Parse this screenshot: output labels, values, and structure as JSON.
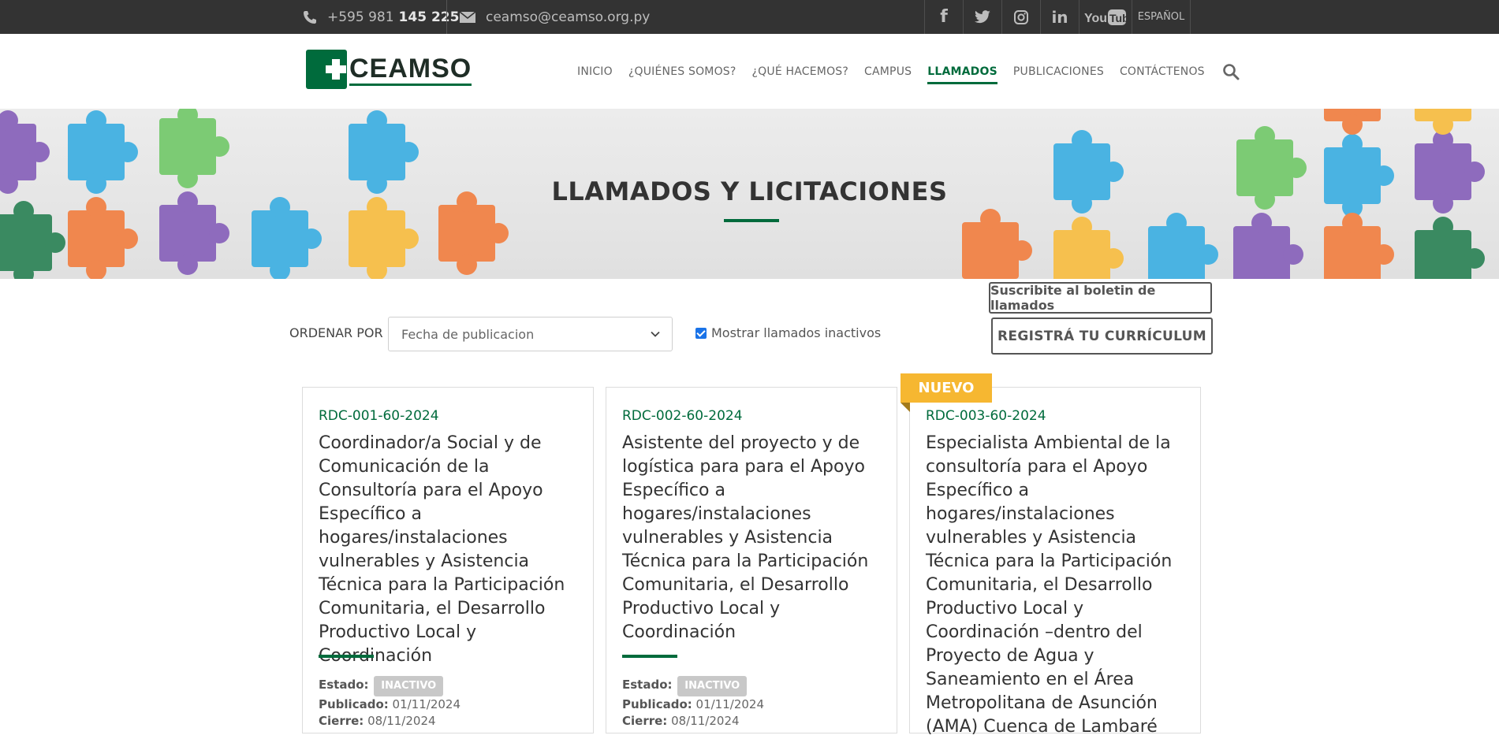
{
  "topbar": {
    "phone_prefix": "+595 981",
    "phone_number": "145 225",
    "email": "ceamso@ceamso.org.py",
    "socials": [
      "facebook-icon",
      "twitter-icon",
      "instagram-icon",
      "linkedin-icon",
      "youtube-icon"
    ],
    "language": "ESPAÑOL"
  },
  "header": {
    "logo_text": "CEAMSO",
    "nav": [
      {
        "label": "INICIO",
        "active": false
      },
      {
        "label": "¿QUIÉNES SOMOS?",
        "active": false
      },
      {
        "label": "¿QUÉ HACEMOS?",
        "active": false
      },
      {
        "label": "CAMPUS",
        "active": false
      },
      {
        "label": "LLAMADOS",
        "active": true
      },
      {
        "label": "PUBLICACIONES",
        "active": false
      },
      {
        "label": "CONTÁCTENOS",
        "active": false
      }
    ]
  },
  "banner": {
    "title": "LLAMADOS Y LICITACIONES"
  },
  "filters": {
    "sort_label": "ORDENAR POR",
    "sort_value": "Fecha de publicacion",
    "inactive_label": "Mostrar llamados inactivos",
    "inactive_checked": true,
    "subscribe_button": "Suscribite al boletin de llamados",
    "cv_button": "REGISTRÁ TU CURRÍCULUM"
  },
  "cards": [
    {
      "code": "RDC-001-60-2024",
      "title": "Coordinador/a Social y de Comunicación de la Consultoría para el Apoyo Específico a hogares/instalaciones vulnerables y Asistencia Técnica para la Participación Comunitaria, el Desarrollo Productivo Local y Coordinación",
      "estado_label": "Estado:",
      "estado": "INACTIVO",
      "publicado_label": "Publicado:",
      "publicado": "01/11/2024",
      "cierre_label": "Cierre:",
      "cierre": "08/11/2024"
    },
    {
      "code": "RDC-002-60-2024",
      "title": "Asistente del proyecto y de logística para para el Apoyo Específico a hogares/instalaciones vulnerables y Asistencia Técnica para la Participación Comunitaria, el Desarrollo Productivo Local y Coordinación",
      "estado_label": "Estado:",
      "estado": "INACTIVO",
      "publicado_label": "Publicado:",
      "publicado": "01/11/2024",
      "cierre_label": "Cierre:",
      "cierre": "08/11/2024"
    },
    {
      "code": "RDC-003-60-2024",
      "ribbon": "NUEVO",
      "title": "Especialista Ambiental de la consultoría para el Apoyo Específico a hogares/instalaciones vulnerables y Asistencia Técnica para la Participación Comunitaria, el Desarrollo Productivo Local y Coordinación –dentro del Proyecto de Agua y Saneamiento en el Área Metropolitana de Asunción (AMA) Cuenca de Lambaré"
    }
  ],
  "colors": {
    "brand_green": "#006b3c",
    "ribbon": "#f6b731",
    "topbar": "#333333"
  }
}
